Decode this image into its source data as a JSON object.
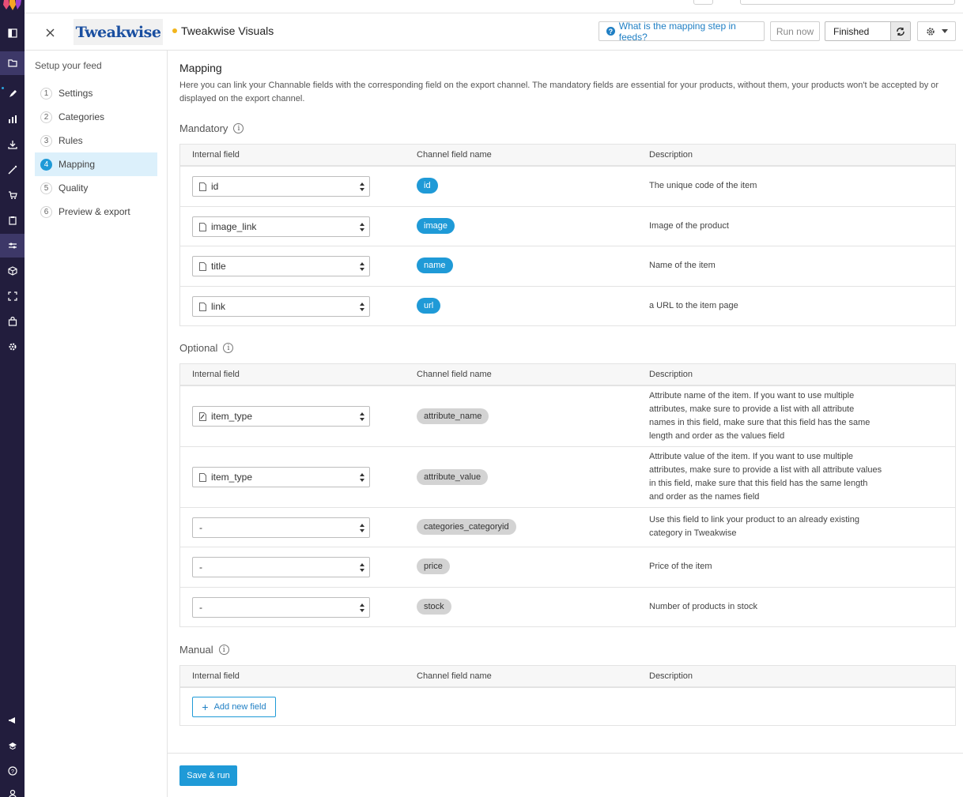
{
  "header": {
    "brand": "Tweakwise",
    "feed_title": "Tweakwise Visuals",
    "help_label": "What is the mapping step in feeds?",
    "run_label": "Run now",
    "status": "Finished"
  },
  "sidebar": {
    "title": "Setup your feed",
    "steps": [
      {
        "num": "1",
        "label": "Settings"
      },
      {
        "num": "2",
        "label": "Categories"
      },
      {
        "num": "3",
        "label": "Rules"
      },
      {
        "num": "4",
        "label": "Mapping"
      },
      {
        "num": "5",
        "label": "Quality"
      },
      {
        "num": "6",
        "label": "Preview & export"
      }
    ]
  },
  "main": {
    "title": "Mapping",
    "description": "Here you can link your Channable fields with the corresponding field on the export channel. The mandatory fields are essential for your products, without them, your products won't be accepted by or displayed on the export channel.",
    "columns": {
      "internal": "Internal field",
      "channel": "Channel field name",
      "description": "Description"
    },
    "mandatory": {
      "heading": "Mandatory",
      "rows": [
        {
          "internal": "id",
          "channel": "id",
          "description": "The unique code of the item"
        },
        {
          "internal": "image_link",
          "channel": "image",
          "description": "Image of the product"
        },
        {
          "internal": "title",
          "channel": "name",
          "description": "Name of the item"
        },
        {
          "internal": "link",
          "channel": "url",
          "description": "a URL to the item page"
        }
      ]
    },
    "optional": {
      "heading": "Optional",
      "rows": [
        {
          "internal": "item_type",
          "channel": "attribute_name",
          "description": "Attribute name of the item. If you want to use multiple attributes, make sure to provide a list with all attribute names in this field, make sure that this field has the same length and order as the values field"
        },
        {
          "internal": "item_type",
          "channel": "attribute_value",
          "description": "Attribute value of the item. If you want to use multiple attributes, make sure to provide a list with all attribute values in this field, make sure that this field has the same length and order as the names field"
        },
        {
          "internal": "-",
          "channel": "categories_categoryid",
          "description": "Use this field to link your product to an already existing category in Tweakwise"
        },
        {
          "internal": "-",
          "channel": "price",
          "description": "Price of the item"
        },
        {
          "internal": "-",
          "channel": "stock",
          "description": "Number of products in stock"
        }
      ]
    },
    "manual": {
      "heading": "Manual",
      "add_label": "Add new field"
    },
    "save_label": "Save & run"
  },
  "colors": {
    "nav_bg": "#221d3d",
    "accent": "#1f9ad7",
    "mandatory_tag": "#1f9ad7",
    "optional_tag": "#d3d3d3",
    "status_dot": "#f2b51c"
  }
}
